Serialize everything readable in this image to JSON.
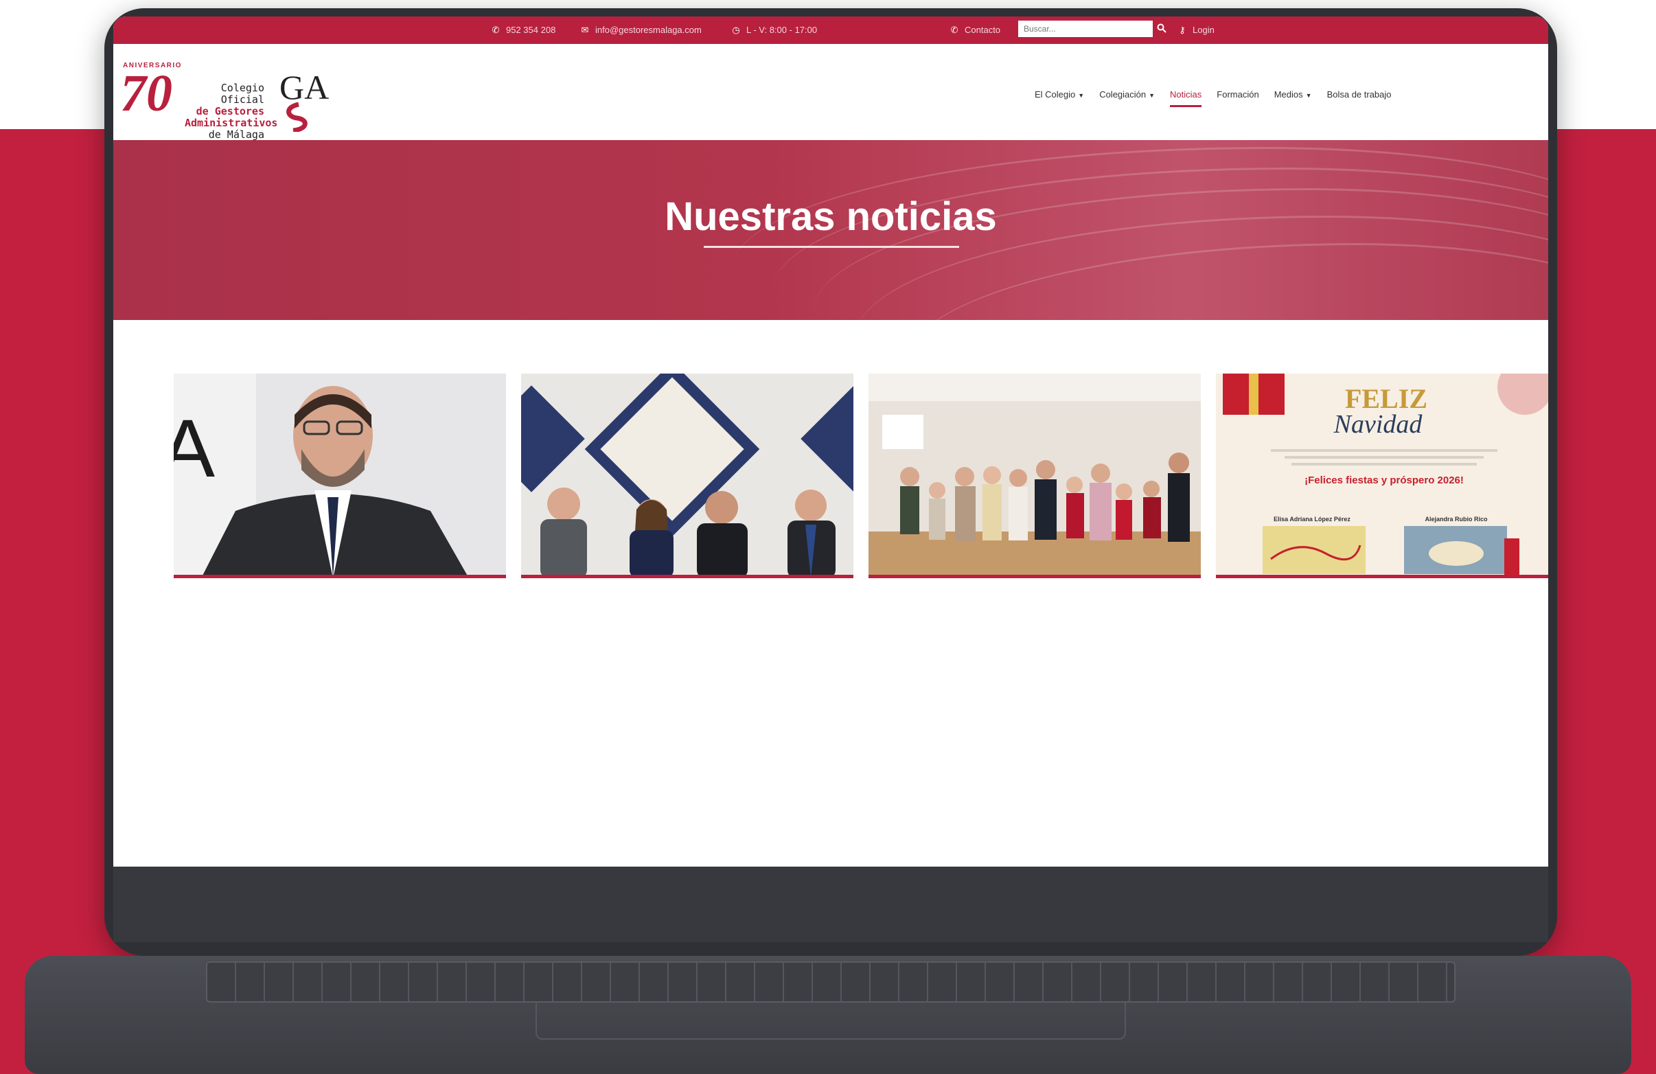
{
  "topbar": {
    "phone": "952 354 208",
    "email": "info@gestoresmalaga.com",
    "hours": "L - V: 8:00 - 17:00",
    "contact": "Contacto",
    "search_placeholder": "Buscar...",
    "login": "Login"
  },
  "logo": {
    "anniversary": "ANIVERSARIO",
    "number": "70",
    "line1": "Colegio Oficial",
    "line2": "de Gestores",
    "line3": "Administrativos",
    "line4": "de Málaga",
    "mark": "GA"
  },
  "nav": {
    "items": [
      {
        "label": "El Colegio",
        "dropdown": true
      },
      {
        "label": "Colegiación",
        "dropdown": true
      },
      {
        "label": "Noticias",
        "dropdown": false,
        "active": true
      },
      {
        "label": "Formación",
        "dropdown": false
      },
      {
        "label": "Medios",
        "dropdown": true
      },
      {
        "label": "Bolsa de trabajo",
        "dropdown": false
      }
    ]
  },
  "hero": {
    "title": "Nuestras noticias"
  },
  "news_cards": {
    "card4": {
      "heading_1": "FELIZ",
      "heading_2": "Navidad",
      "greeting": "¡Felices fiestas y próspero 2026!",
      "author_1": "Elisa Adriana López Pérez",
      "author_2": "Alejandra Rubio Rico"
    }
  },
  "colors": {
    "brand_red": "#b8203e",
    "page_red": "#c3203f",
    "laptop_body": "#2f3035"
  },
  "icons": [
    "phone-icon",
    "mail-icon",
    "clock-icon",
    "search-icon",
    "key-icon"
  ]
}
